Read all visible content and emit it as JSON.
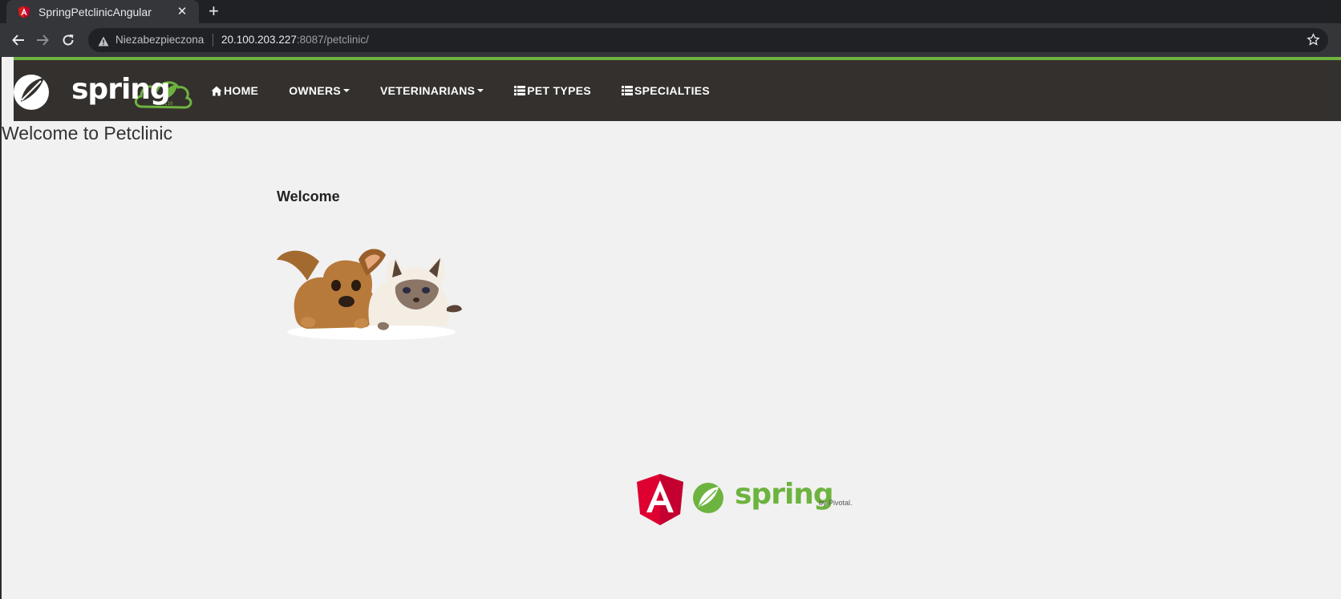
{
  "browser": {
    "tab": {
      "title": "SpringPetclinicAngular",
      "close_label": "✕",
      "favicon": "angular-icon"
    },
    "new_tab_label": "+",
    "security_label": "Niezabezpieczona",
    "url_host": "20.100.203.227",
    "url_rest": ":8087/petclinic/"
  },
  "navbar": {
    "brand_text": "spring",
    "brand_badge": "010110",
    "accent_color": "#6db33f",
    "background_color": "#34302d",
    "items": [
      {
        "label": "HOME",
        "icon": "home-icon"
      },
      {
        "label": "OWNERS",
        "dropdown": true
      },
      {
        "label": "VETERINARIANS",
        "dropdown": true
      },
      {
        "label": "PET TYPES",
        "icon": "list-icon"
      },
      {
        "label": "SPECIALTIES",
        "icon": "list-icon"
      }
    ]
  },
  "main": {
    "page_title": "Welcome to Petclinic",
    "welcome_heading": "Welcome",
    "image": "pets-image"
  },
  "footer": {
    "logos": [
      "angular-logo",
      "spring-logo"
    ],
    "spring_text": "spring",
    "pivotal_text": "by Pivotal."
  }
}
